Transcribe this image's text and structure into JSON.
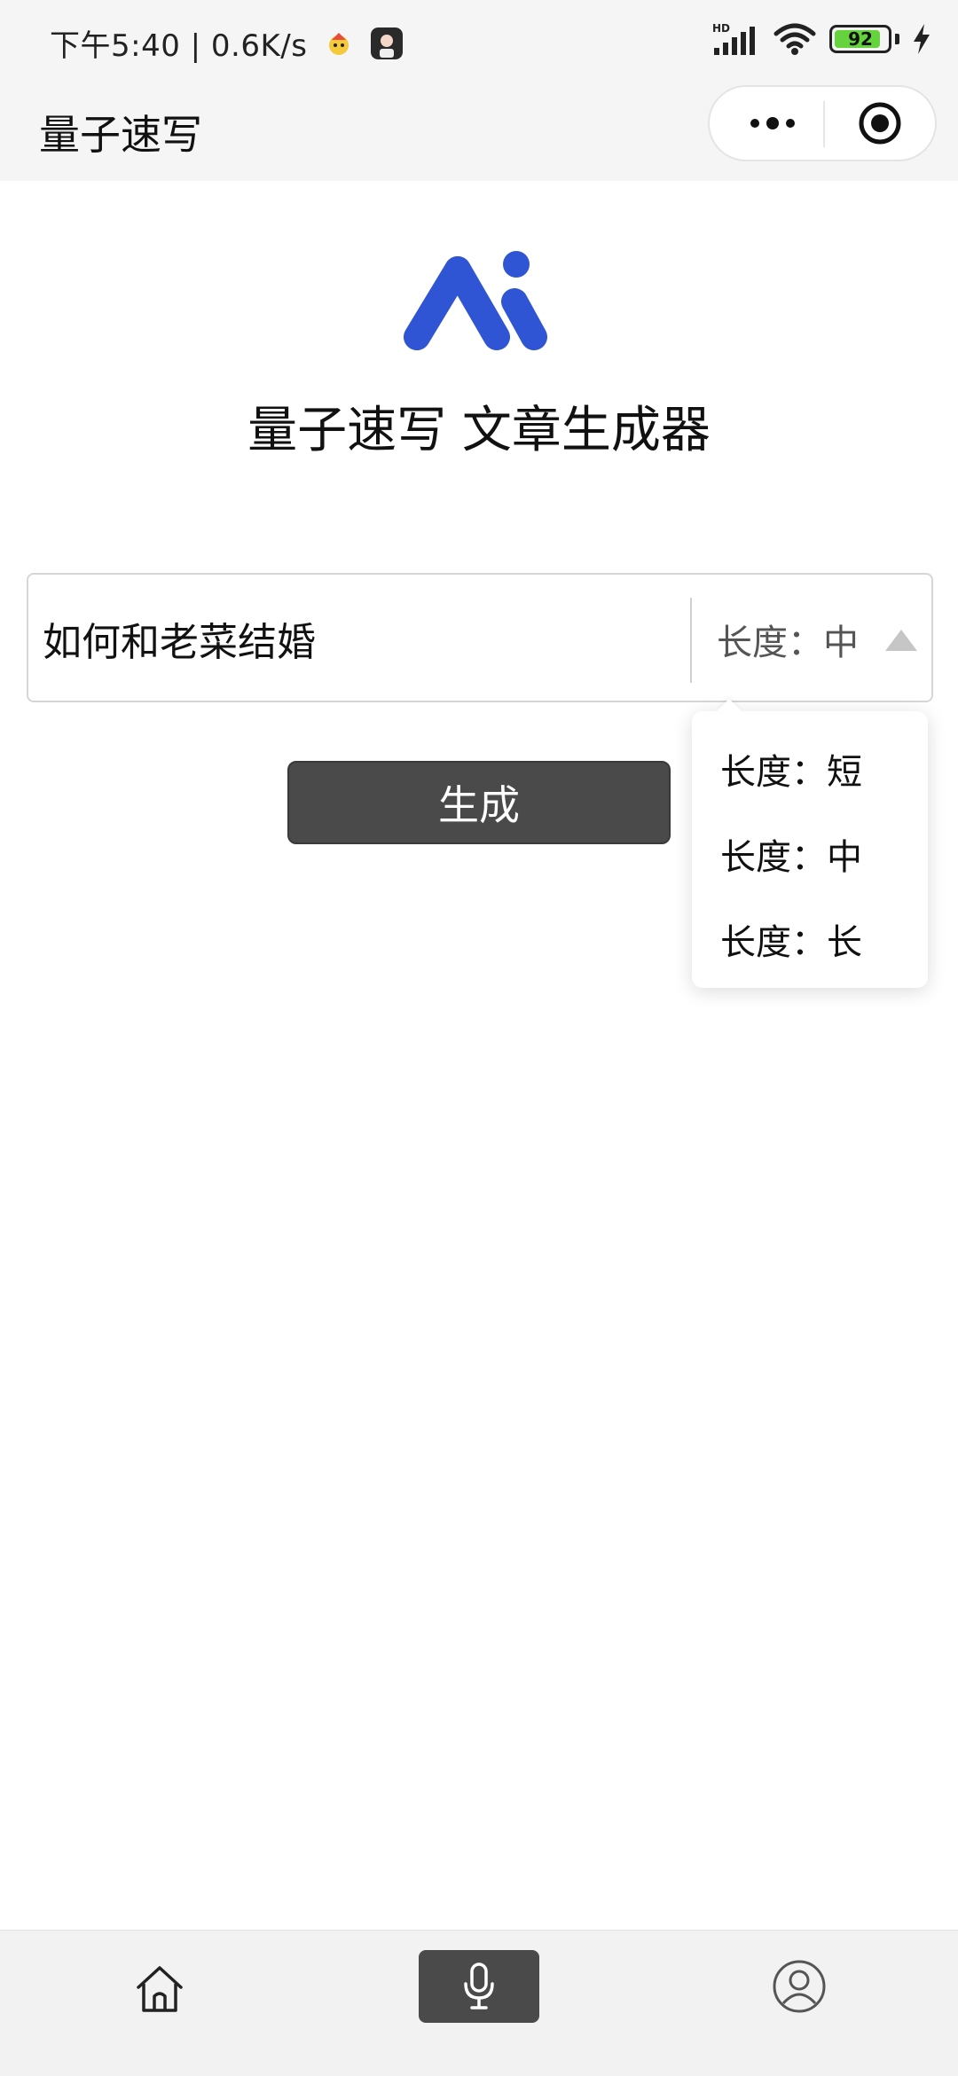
{
  "status_bar": {
    "time_speed": "下午5:40 | 0.6K/s",
    "network_label": "HD",
    "battery": "92"
  },
  "title_bar": {
    "app_title": "量子速写"
  },
  "main": {
    "heading": "量子速写 文章生成器",
    "topic_value": "如何和老菜结婚",
    "length_selected": "长度：中",
    "generate_label": "生成"
  },
  "dropdown": {
    "options": [
      "长度：短",
      "长度：中",
      "长度：长"
    ]
  },
  "colors": {
    "logo_blue": "#2f55d4",
    "button_dark": "#4a4a4a",
    "battery_green": "#65d33b"
  },
  "icons": [
    "home-icon",
    "microphone-icon",
    "profile-icon",
    "more-icon",
    "close-miniprogram-icon",
    "wifi-icon",
    "signal-icon",
    "battery-icon",
    "charging-icon"
  ]
}
